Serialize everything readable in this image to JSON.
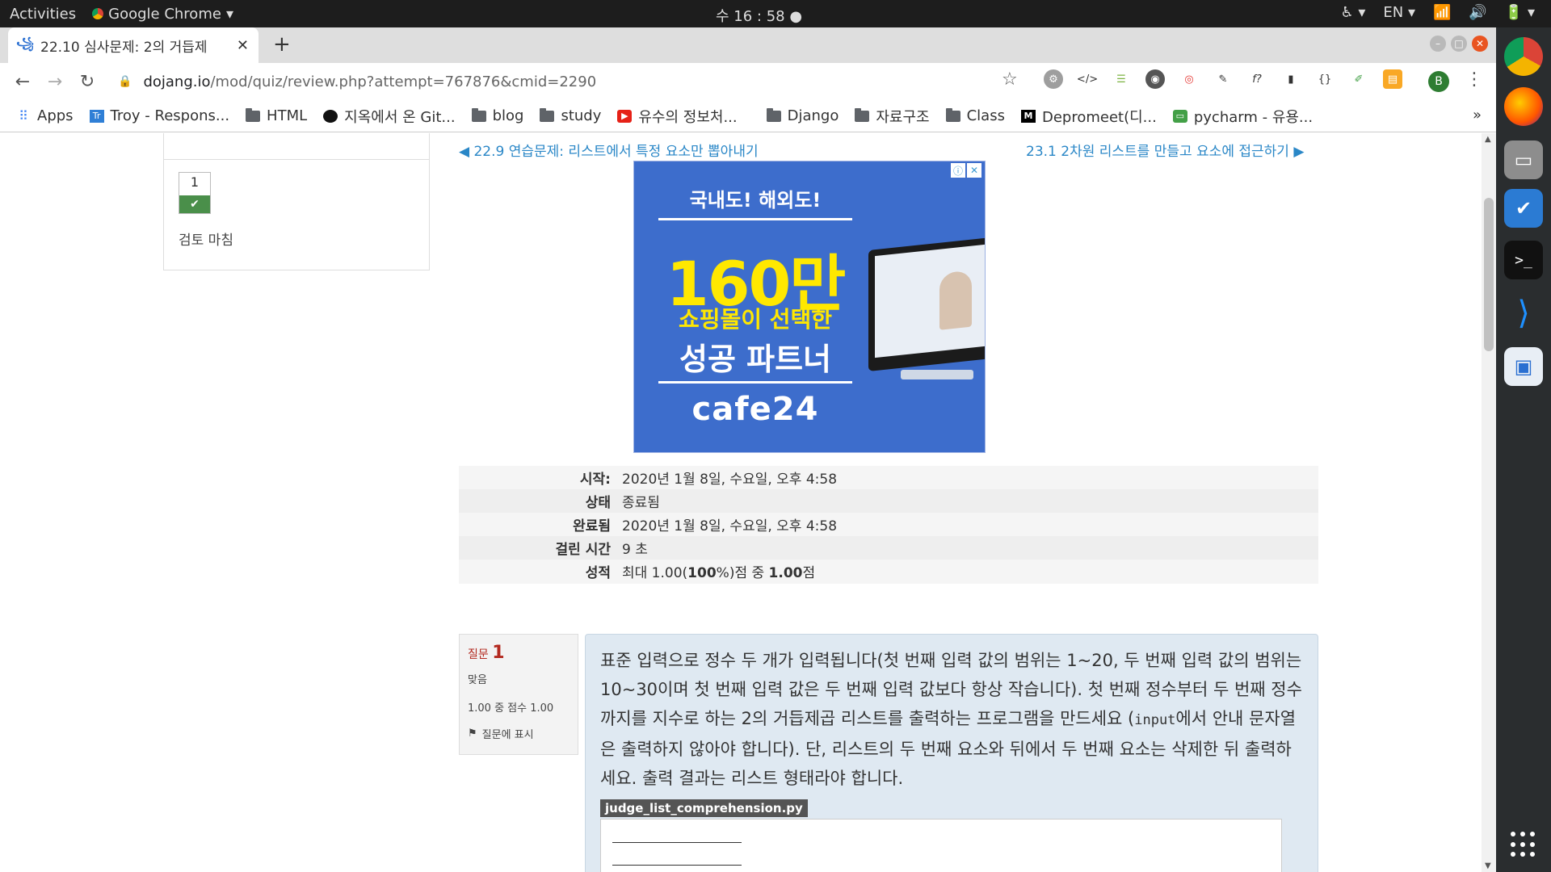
{
  "topbar": {
    "activities": "Activities",
    "app_name": "Google Chrome",
    "clock": "수 16 : 58",
    "lang": "EN"
  },
  "tab": {
    "favicon": "dojang-icon",
    "title": "22.10 심사문제: 2의 거듭제"
  },
  "address": {
    "host": "dojang.io",
    "path": "/mod/quiz/review.php?attempt=767876&cmid=2290"
  },
  "profile_initial": "B",
  "bookmarks": [
    {
      "label": "Apps",
      "icon": "apps-grid-icon"
    },
    {
      "label": "Troy - Respons...",
      "icon": "trello-icon"
    },
    {
      "label": "HTML",
      "icon": "folder-icon"
    },
    {
      "label": "지옥에서 온 Git...",
      "icon": "github-icon"
    },
    {
      "label": "blog",
      "icon": "folder-icon"
    },
    {
      "label": "study",
      "icon": "folder-icon"
    },
    {
      "label": "유수의 정보처...",
      "icon": "youtube-icon"
    },
    {
      "label": "Django",
      "icon": "folder-icon"
    },
    {
      "label": "자료구조",
      "icon": "folder-icon"
    },
    {
      "label": "Class",
      "icon": "folder-icon"
    },
    {
      "label": "Depromeet(디...",
      "icon": "medium-icon"
    },
    {
      "label": "pycharm - 유용...",
      "icon": "line-icon"
    }
  ],
  "bookmarks_more": "»",
  "quiz_nav": {
    "question_number": "1",
    "finish_review": "검토 마침"
  },
  "links": {
    "prev": "◀ 22.9 연습문제: 리스트에서 특정 요소만 뽑아내기",
    "next": "23.1 2차원 리스트를 만들고 요소에 접근하기 ▶"
  },
  "ad": {
    "headline": "국내도! 해외도!",
    "big": "160만",
    "sub1": "쇼핑몰이 선택한",
    "sub2": "성공 파트너",
    "brand": "cafe24"
  },
  "summary": [
    {
      "label": "시작:",
      "value": "2020년 1월 8일, 수요일, 오후 4:58"
    },
    {
      "label": "상태",
      "value": "종료됨"
    },
    {
      "label": "완료됨",
      "value": "2020년 1월 8일, 수요일, 오후 4:58"
    },
    {
      "label": "걸린 시간",
      "value": "9 초"
    },
    {
      "label": "성적",
      "value_pre": "최대 1.00(",
      "value_b1": "100",
      "value_mid": "%)점 중 ",
      "value_b2": "1.00",
      "value_post": "점"
    }
  ],
  "question": {
    "label": "질문",
    "number": "1",
    "state": "맞음",
    "grade": "1.00 중 점수 1.00",
    "flag": "질문에 표시",
    "text_1": "표준 입력으로 정수 두 개가 입력됩니다(첫 번째 입력 값의 범위는 1~20, 두 번째 입력 값의 범위는 10~30이며 첫 번째 입력 값은 두 번째 입력 값보다 항상 작습니다). 첫 번째 정수부터 두 번째 정수까지를 지수로 하는 2의 거듭제곱 리스트를 출력하는 프로그램을 만드세요 (",
    "text_code": "input",
    "text_2": "에서 안내 문자열은 출력하지 않아야 합니다). 단, 리스트의 두 번째 요소와 뒤에서 두 번째 요소는 삭제한 뒤 출력하세요. 출력 결과는 리스트 형태라야 합니다.",
    "file_label": "judge_list_comprehension.py"
  }
}
